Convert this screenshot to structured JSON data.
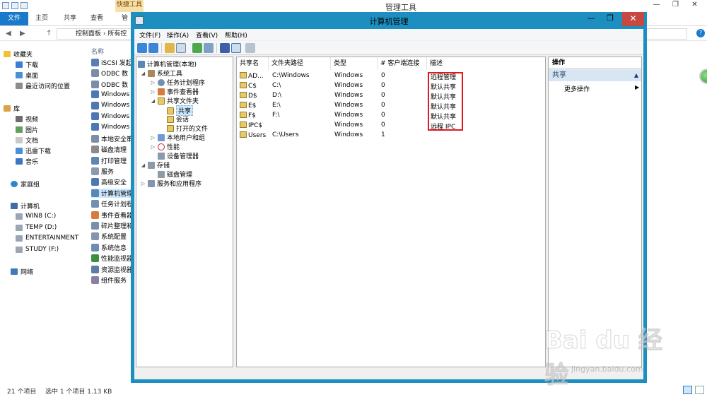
{
  "explorer": {
    "context_tab": "快捷工具",
    "window_title": "管理工具",
    "window_controls": [
      "—",
      "❐",
      "✕"
    ],
    "ribbon_tabs": [
      "文件",
      "主页",
      "共享",
      "查看",
      "管"
    ],
    "address_text": "控制面板 › 所有控",
    "nav": {
      "favorites": "收藏夹",
      "fav_items": [
        "下载",
        "桌面",
        "最近访问的位置"
      ],
      "library": "库",
      "lib_items": [
        "视频",
        "图片",
        "文档",
        "迅雷下载",
        "音乐"
      ],
      "homegroup": "家庭组",
      "computer": "计算机",
      "drives": [
        "WIN8 (C:)",
        "TEMP (D:)",
        "ENTERTAINMENT",
        "STUDY (F:)"
      ],
      "network": "网络"
    },
    "list_header": "名称",
    "list_items": [
      "iSCSI 发起",
      "ODBC 数",
      "ODBC 数",
      "Windows",
      "Windows",
      "Windows",
      "Windows",
      "本地安全策",
      "磁盘清理",
      "打印管理",
      "服务",
      "高级安全",
      "计算机管理",
      "任务计划程",
      "事件查看器",
      "碎片整理和",
      "系统配置",
      "系统信息",
      "性能监视器",
      "资源监视器",
      "组件服务"
    ],
    "selected_item_index": 12,
    "status_count": "21 个项目",
    "status_selected": "选中 1 个项目  1.13 KB"
  },
  "cm": {
    "title": "计算机管理",
    "close": "✕",
    "minimize": "—",
    "maximize": "❐",
    "menu": [
      "文件(F)",
      "操作(A)",
      "查看(V)",
      "帮助(H)"
    ],
    "tree": {
      "root": "计算机管理(本地)",
      "system_tools": "系统工具",
      "task_scheduler": "任务计划程序",
      "event_viewer": "事件查看器",
      "shared_folders": "共享文件夹",
      "shares": "共享",
      "sessions": "会话",
      "open_files": "打开的文件",
      "local_users": "本地用户和组",
      "performance": "性能",
      "device_manager": "设备管理器",
      "storage": "存储",
      "disk_mgmt": "磁盘管理",
      "services_apps": "服务和应用程序"
    },
    "columns": [
      "共享名",
      "文件夹路径",
      "类型",
      "# 客户端连接",
      "描述"
    ],
    "rows": [
      {
        "name": "AD...",
        "path": "C:\\Windows",
        "type": "Windows",
        "clients": "0",
        "desc": "远程管理"
      },
      {
        "name": "C$",
        "path": "C:\\",
        "type": "Windows",
        "clients": "0",
        "desc": "默认共享"
      },
      {
        "name": "D$",
        "path": "D:\\",
        "type": "Windows",
        "clients": "0",
        "desc": "默认共享"
      },
      {
        "name": "E$",
        "path": "E:\\",
        "type": "Windows",
        "clients": "0",
        "desc": "默认共享"
      },
      {
        "name": "F$",
        "path": "F:\\",
        "type": "Windows",
        "clients": "0",
        "desc": "默认共享"
      },
      {
        "name": "IPC$",
        "path": "",
        "type": "Windows",
        "clients": "0",
        "desc": "远程 IPC"
      },
      {
        "name": "Users",
        "path": "C:\\Users",
        "type": "Windows",
        "clients": "1",
        "desc": ""
      }
    ],
    "actions": {
      "header": "操作",
      "section": "共享",
      "more": "更多操作"
    }
  },
  "watermark": {
    "logo": "Bai du 经验",
    "url": "jingyan.baidu.com"
  },
  "colors": {
    "window_border": "#1c8fc0",
    "close": "#c7483f",
    "highlight_box": "#e0191f",
    "ribbon_file": "#1979ca"
  }
}
